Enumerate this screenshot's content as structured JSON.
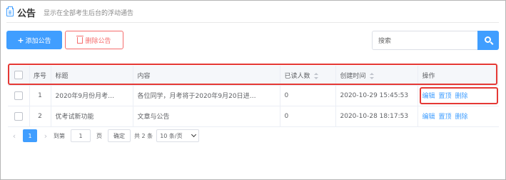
{
  "header": {
    "icon": "notice-icon",
    "title": "公告",
    "description": "显示在全部考生后台的浮动通告"
  },
  "toolbar": {
    "add_label": "添加公告",
    "delete_label": "删除公告",
    "search_placeholder": "搜索"
  },
  "table": {
    "columns": [
      "",
      "序号",
      "标题",
      "内容",
      "已读人数",
      "创建时间",
      "操作"
    ],
    "rows": [
      {
        "index": "1",
        "title": "2020年9月份月考…",
        "content": "各位同学，月考将于2020年9月20日进…",
        "reads": "0",
        "created": "2020-10-29 15:45:53"
      },
      {
        "index": "2",
        "title": "优考试新功能",
        "content": "文章与公告",
        "reads": "0",
        "created": "2020-10-28 18:17:53"
      }
    ],
    "actions": {
      "edit": "编辑",
      "pin": "置顶",
      "delete": "删除"
    }
  },
  "pagination": {
    "current_page": "1",
    "goto_label": "到第",
    "page_input": "1",
    "page_unit": "页",
    "confirm_label": "确定",
    "total": "共 2 条",
    "page_size": "10 条/页"
  },
  "colors": {
    "primary": "#409eff",
    "danger": "#f56c6c",
    "highlight": "#e53935"
  }
}
